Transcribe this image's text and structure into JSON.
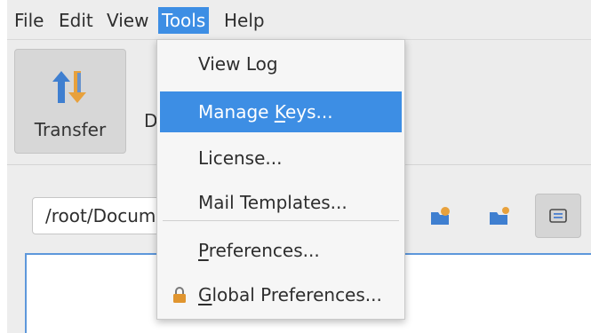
{
  "menubar": {
    "items": [
      {
        "label": "File"
      },
      {
        "label": "Edit"
      },
      {
        "label": "View"
      },
      {
        "label": "Tools"
      },
      {
        "label": "Help"
      }
    ]
  },
  "toolbar": {
    "transfer_label": "Transfer",
    "partial_label": "D"
  },
  "pathbar": {
    "path_value": "/root/Docum"
  },
  "tools_menu": {
    "items": [
      {
        "label": "View Log"
      },
      {
        "label": "Manage ",
        "mnemonic": "K",
        "rest": "eys..."
      },
      {
        "label": "License..."
      },
      {
        "label": "Mail Templates..."
      },
      {
        "label": "",
        "mnemonic": "P",
        "rest": "references..."
      },
      {
        "label": "",
        "mnemonic": "G",
        "rest": "lobal Preferences..."
      }
    ]
  },
  "colors": {
    "accent": "#3d8ee4",
    "menu_bg": "#f6f6f6",
    "window_bg": "#ededed"
  },
  "icons": {
    "transfer": "transfer-arrows-icon",
    "lock": "lock-icon",
    "upload": "folder-upload-icon",
    "download": "folder-download-icon",
    "list_view": "list-view-icon"
  }
}
